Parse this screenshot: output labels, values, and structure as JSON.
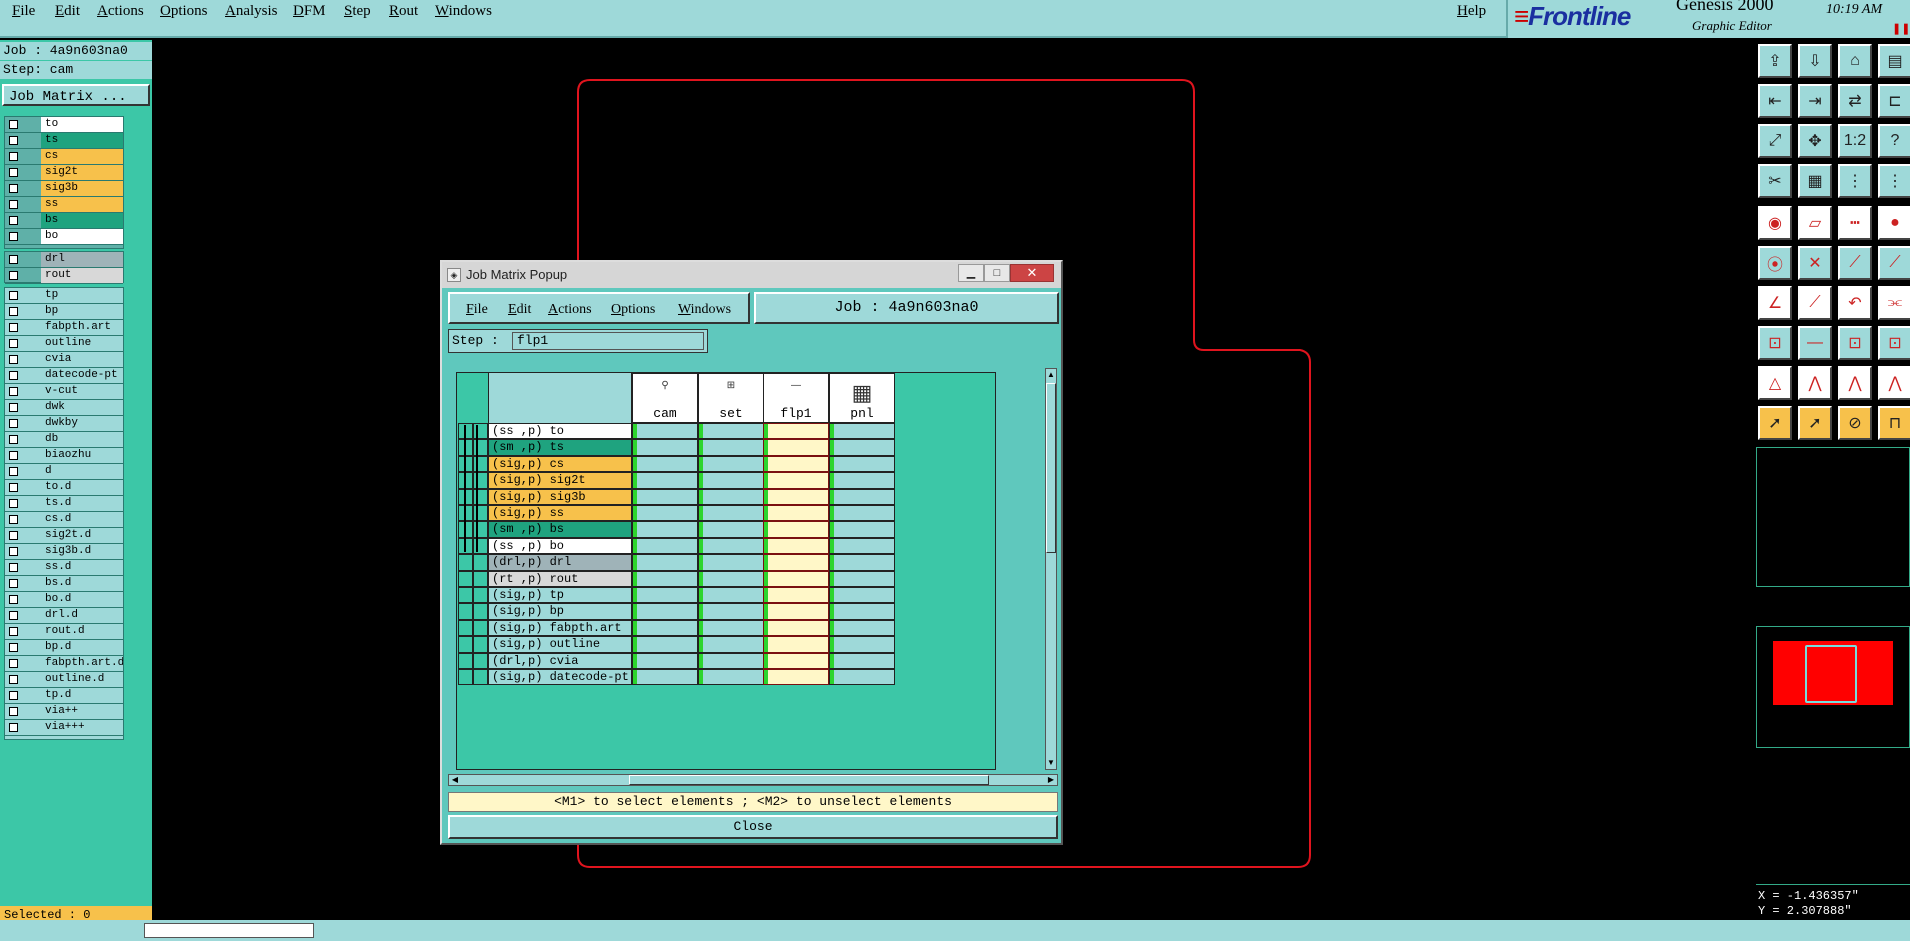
{
  "menubar": {
    "items": [
      "File",
      "Edit",
      "Actions",
      "Options",
      "Analysis",
      "DFM",
      "Step",
      "Rout",
      "Windows"
    ],
    "help": "Help",
    "brand": "Frontline",
    "product": "Genesis 2000",
    "subtitle": "Graphic Editor",
    "time": "10:19 AM"
  },
  "left": {
    "job": "Job : 4a9n603na0",
    "step": "Step: cam",
    "matrix_button": "Job Matrix ...",
    "layers_top": [
      {
        "name": "to",
        "color": "#ffffff"
      },
      {
        "name": "ts",
        "color": "#1fa37f"
      },
      {
        "name": "cs",
        "color": "#f7c14b"
      },
      {
        "name": "sig2t",
        "color": "#f7c14b"
      },
      {
        "name": "sig3b",
        "color": "#f7c14b"
      },
      {
        "name": "ss",
        "color": "#f7c14b"
      },
      {
        "name": "bs",
        "color": "#1fa37f"
      },
      {
        "name": "bo",
        "color": "#ffffff"
      }
    ],
    "layers_mid": [
      {
        "name": "drl",
        "color": "#9fb3b8"
      },
      {
        "name": "rout",
        "color": "#d8d8d8"
      }
    ],
    "layers_misc": [
      "tp",
      "bp",
      "fabpth.art",
      "outline",
      "cvia",
      "datecode-pt",
      "v-cut",
      "dwk",
      "dwkby",
      "db",
      "biaozhu",
      "d",
      "to.d",
      "ts.d",
      "cs.d",
      "sig2t.d",
      "sig3b.d",
      "ss.d",
      "bs.d",
      "bo.d",
      "drl.d",
      "rout.d",
      "bp.d",
      "fabpth.art.d",
      "outline.d",
      "tp.d",
      "via++",
      "via+++"
    ],
    "selected": "Selected : 0"
  },
  "popup": {
    "title": "Job Matrix Popup",
    "menu": [
      "File",
      "Edit",
      "Actions",
      "Options",
      "Windows"
    ],
    "job": "Job : 4a9n603na0",
    "step_label": "Step :",
    "step_value": "flp1",
    "columns": [
      "cam",
      "set",
      "flp1",
      "pnl"
    ],
    "rows": [
      {
        "label": "(ss ,p) to",
        "color": "#ffffff"
      },
      {
        "label": "(sm ,p) ts",
        "color": "#1fa37f"
      },
      {
        "label": "(sig,p) cs",
        "color": "#f7c14b"
      },
      {
        "label": "(sig,p) sig2t",
        "color": "#f7c14b"
      },
      {
        "label": "(sig,p) sig3b",
        "color": "#f7c14b"
      },
      {
        "label": "(sig,p) ss",
        "color": "#f7c14b"
      },
      {
        "label": "(sm ,p) bs",
        "color": "#1fa37f"
      },
      {
        "label": "(ss ,p) bo",
        "color": "#ffffff"
      },
      {
        "label": "(drl,p) drl",
        "color": "#9fb3b8"
      },
      {
        "label": "(rt ,p) rout",
        "color": "#d8d8d8"
      },
      {
        "label": "(sig,p) tp",
        "color": "#9ed9d9"
      },
      {
        "label": "(sig,p) bp",
        "color": "#9ed9d9"
      },
      {
        "label": "(sig,p) fabpth.art",
        "color": "#9ed9d9"
      },
      {
        "label": "(sig,p) outline",
        "color": "#9ed9d9"
      },
      {
        "label": "(drl,p) cvia",
        "color": "#9ed9d9"
      },
      {
        "label": "(sig,p) datecode-pt",
        "color": "#9ed9d9"
      }
    ],
    "hint": "<M1> to select elements ; <M2> to unselect elements",
    "close": "Close"
  },
  "coords": {
    "x": "X = -1.436357\"",
    "y": "Y = 2.307888\""
  },
  "colors": {
    "panel": "#9ed9d9",
    "accent": "#3cc7a7",
    "outline": "#e0141e",
    "highlight": "#fff7c8"
  }
}
